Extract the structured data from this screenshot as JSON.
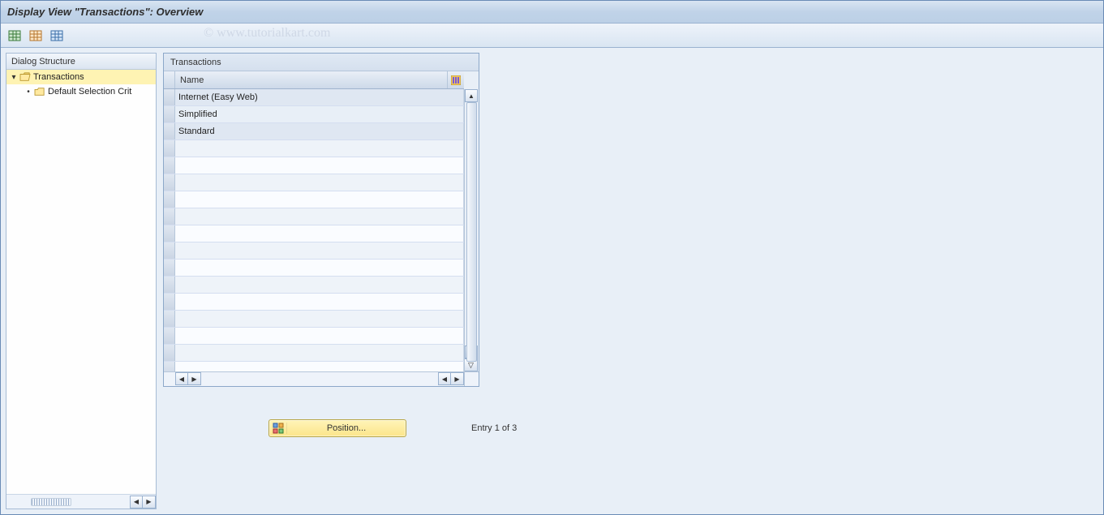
{
  "title": "Display View \"Transactions\": Overview",
  "watermark": "© www.tutorialkart.com",
  "tree": {
    "header": "Dialog Structure",
    "root": {
      "label": "Transactions",
      "icon": "open-folder"
    },
    "child": {
      "label": "Default Selection Crit",
      "icon": "folder"
    }
  },
  "table": {
    "title": "Transactions",
    "column": "Name",
    "rows": [
      "Internet (Easy Web)",
      "Simplified",
      "Standard"
    ]
  },
  "footer": {
    "position_label": "Position...",
    "status": "Entry 1 of 3"
  },
  "toolbar": {
    "btn1": "display-icon",
    "btn2": "worklist-icon",
    "btn3": "table-settings-icon"
  }
}
